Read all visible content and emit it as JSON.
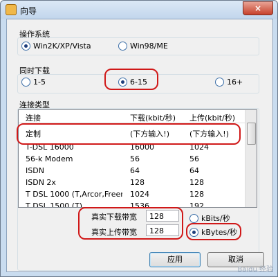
{
  "window": {
    "title": "向导",
    "close_glyph": "×"
  },
  "os_group": {
    "label": "操作系统",
    "options": [
      {
        "label": "Win2K/XP/Vista",
        "selected": true
      },
      {
        "label": "Win98/ME",
        "selected": false
      }
    ]
  },
  "download_group": {
    "label": "同时下载",
    "options": [
      {
        "label": "1-5",
        "selected": false
      },
      {
        "label": "6-15",
        "selected": true
      },
      {
        "label": "16+",
        "selected": false
      }
    ]
  },
  "connection_group": {
    "label": "连接类型",
    "columns": [
      "连接",
      "下载(kbit/秒)",
      "上传(kbit/秒)"
    ],
    "rows": [
      [
        "定制",
        "(下方输入!)",
        "(下方输入!)"
      ],
      [
        "T-DSL 16000",
        "16000",
        "1024"
      ],
      [
        "56-k Modem",
        "56",
        "56"
      ],
      [
        "ISDN",
        "64",
        "64"
      ],
      [
        "ISDN 2x",
        "128",
        "128"
      ],
      [
        "T DSL 1000 (T,Arcor,Freen...",
        "1024",
        "128"
      ],
      [
        "T DSL 1500 (T)",
        "1536",
        "192"
      ]
    ],
    "selected_row": 0
  },
  "bandwidth": {
    "download_label": "真实下载带宽",
    "download_value": "128",
    "upload_label": "真实上传带宽",
    "upload_value": "128",
    "unit_options": [
      {
        "label": "kBits/秒",
        "selected": false
      },
      {
        "label": "kBytes/秒",
        "selected": true
      }
    ]
  },
  "buttons": {
    "apply": "应用",
    "cancel": "取消"
  },
  "watermark": "Baidu 经验",
  "colors": {
    "annotation_red": "#d01818",
    "selection_blue": "#1d3d7a"
  }
}
